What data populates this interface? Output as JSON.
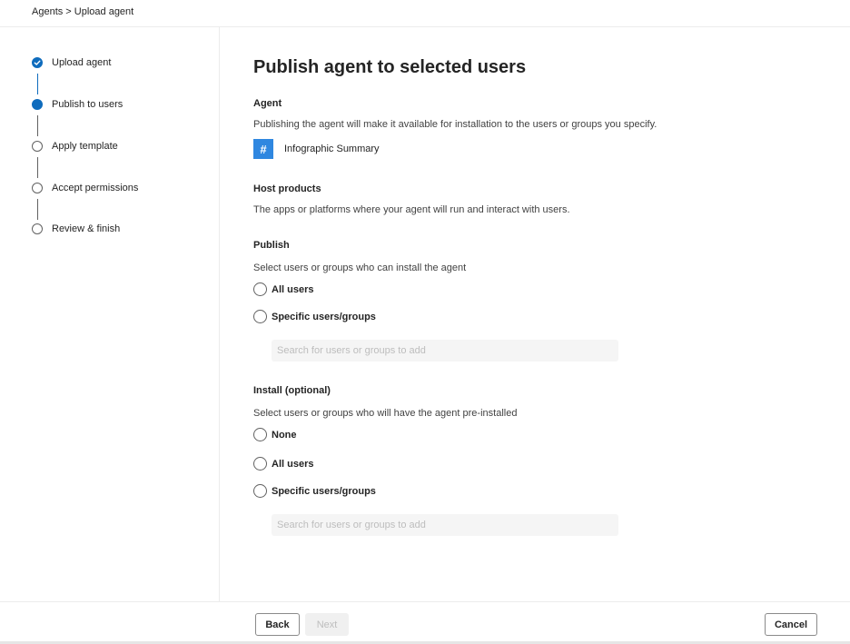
{
  "breadcrumb": "Agents > Upload agent",
  "steps": [
    {
      "label": "Upload agent",
      "state": "done"
    },
    {
      "label": "Publish to users",
      "state": "current"
    },
    {
      "label": "Apply template",
      "state": "pending"
    },
    {
      "label": "Accept permissions",
      "state": "pending"
    },
    {
      "label": "Review & finish",
      "state": "pending"
    }
  ],
  "main": {
    "title": "Publish agent to selected users",
    "agent_section": {
      "heading": "Agent",
      "description": "Publishing the agent will make it available for installation to the users or groups you specify.",
      "agent_icon_glyph": "#",
      "agent_name": "Infographic Summary"
    },
    "host_section": {
      "heading": "Host products",
      "description": "The apps or platforms where your agent will run and interact with users."
    },
    "publish_section": {
      "heading": "Publish",
      "description": "Select users or groups who can install the agent",
      "options": [
        "All users",
        "Specific users/groups"
      ],
      "search_placeholder": "Search for users or groups to add"
    },
    "install_section": {
      "heading": "Install (optional)",
      "description": "Select users or groups who will have the agent pre-installed",
      "options": [
        "None",
        "All users",
        "Specific users/groups"
      ],
      "search_placeholder": "Search for users or groups to add"
    }
  },
  "footer": {
    "back_label": "Back",
    "next_label": "Next",
    "cancel_label": "Cancel"
  },
  "colors": {
    "accent": "#0f6cbd",
    "agent_icon_bg": "#2f87e0"
  }
}
